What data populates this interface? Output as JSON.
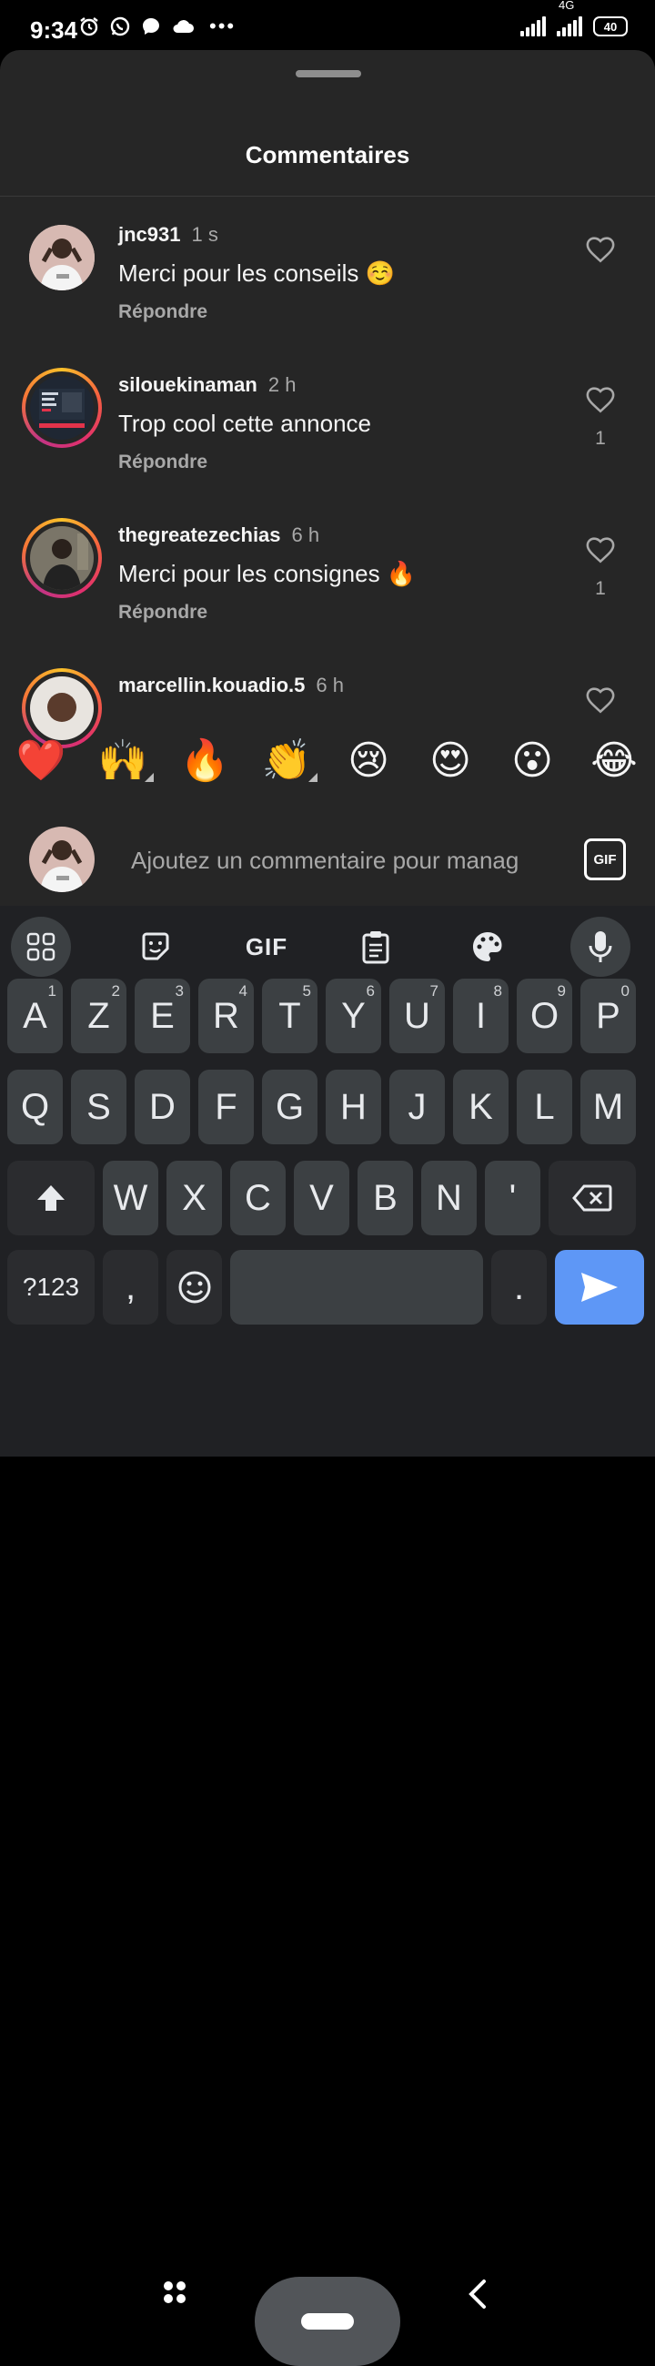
{
  "status_bar": {
    "time": "9:34",
    "network": "4G",
    "battery": "40",
    "more": "•••"
  },
  "sheet": {
    "title": "Commentaires"
  },
  "comments": [
    {
      "user": "jnc931",
      "time": "1 s",
      "text": "Merci pour les conseils ☺️",
      "reply": "Répondre",
      "likes": ""
    },
    {
      "user": "silouekinaman",
      "time": "2 h",
      "text": "Trop cool cette annonce",
      "reply": "Répondre",
      "likes": "1"
    },
    {
      "user": "thegreatezechias",
      "time": "6 h",
      "text": "Merci pour les consignes 🔥",
      "reply": "Répondre",
      "likes": "1"
    },
    {
      "user": "marcellin.kouadio.5",
      "time": "6 h",
      "text": "",
      "reply": "",
      "likes": ""
    }
  ],
  "emojis": [
    "❤️",
    "🙌",
    "🔥",
    "👏",
    "😢",
    "😍",
    "😮",
    "😂"
  ],
  "composer": {
    "placeholder": "Ajoutez un commentaire pour manag",
    "gif_label": "GIF"
  },
  "keyboard": {
    "toolbar_gif": "GIF",
    "row1": [
      "A",
      "Z",
      "E",
      "R",
      "T",
      "Y",
      "U",
      "I",
      "O",
      "P"
    ],
    "row1_numbers": [
      "1",
      "2",
      "3",
      "4",
      "5",
      "6",
      "7",
      "8",
      "9",
      "0"
    ],
    "row2": [
      "Q",
      "S",
      "D",
      "F",
      "G",
      "H",
      "J",
      "K",
      "L",
      "M"
    ],
    "row3": [
      "W",
      "X",
      "C",
      "V",
      "B",
      "N",
      "'"
    ],
    "symbols_label": "?123",
    "comma": ",",
    "period": "."
  },
  "colors": {
    "sheet_bg": "#262626",
    "keyboard_bg": "#202124",
    "key_bg": "#3c4043",
    "send_key": "#5e97f6",
    "secondary_text": "#a8a8a8"
  }
}
